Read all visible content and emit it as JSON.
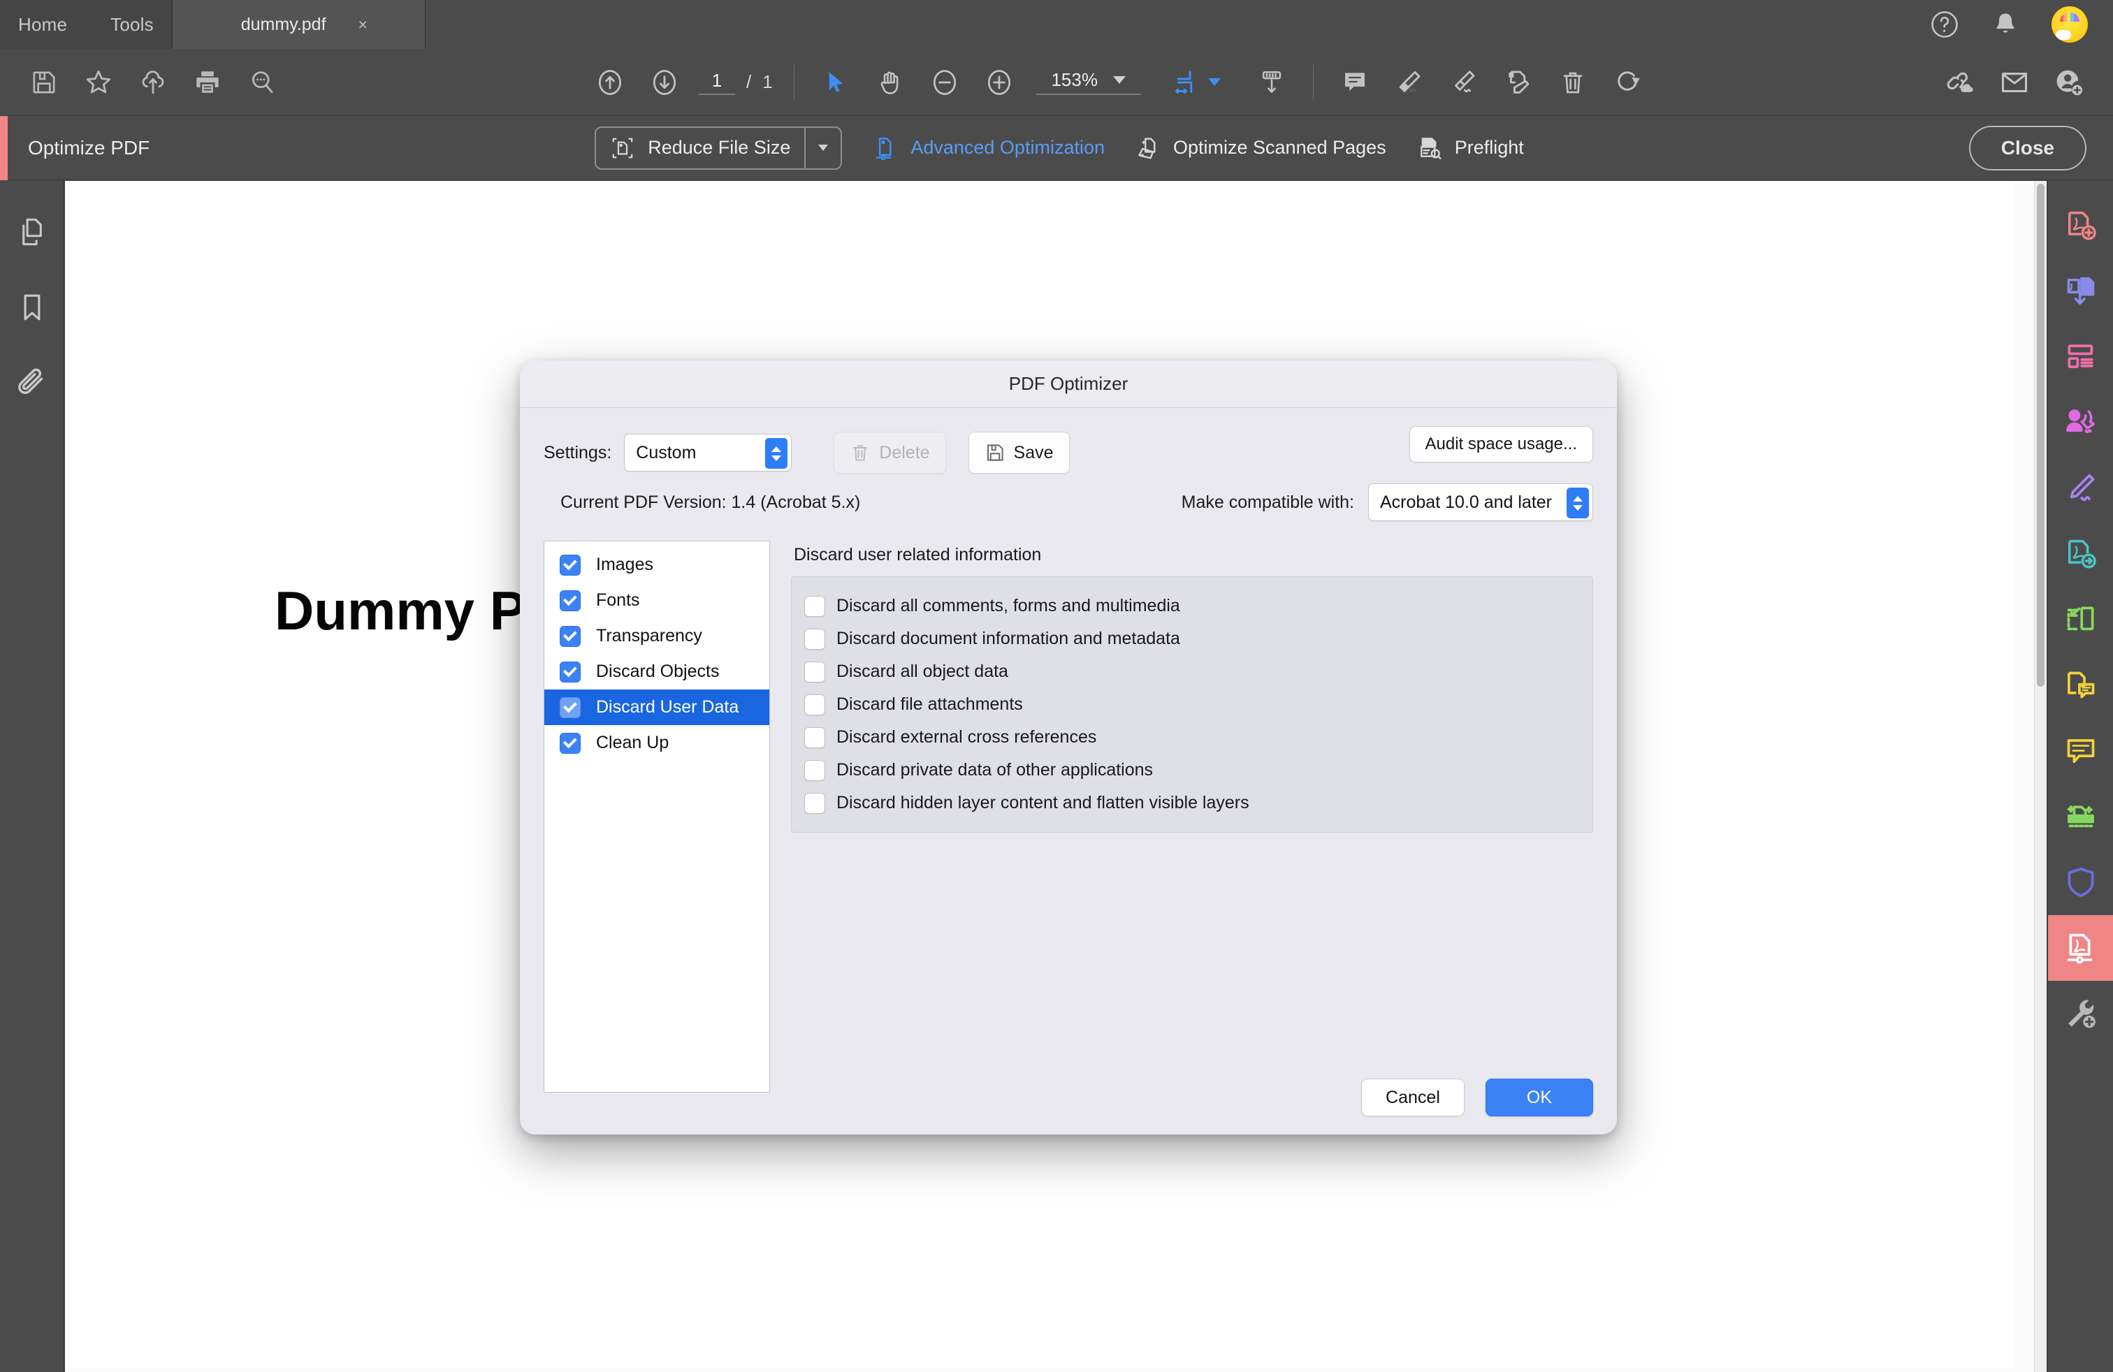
{
  "tabbar": {
    "home_label": "Home",
    "tools_label": "Tools",
    "document_tab": "dummy.pdf",
    "close_tab_glyph": "×",
    "help_icon": "help-circle-icon",
    "bell_icon": "bell-icon",
    "avatar_icon": "user-avatar"
  },
  "toolbar": {
    "save_icon": "save-floppy-icon",
    "star_icon": "star-icon",
    "upload_icon": "cloud-upload-icon",
    "print_icon": "print-icon",
    "findtext_icon": "search-comment-icon",
    "prev_page_icon": "arrow-up-circle-icon",
    "next_page_icon": "arrow-down-circle-icon",
    "page_current": "1",
    "page_sep": "/",
    "page_total": "1",
    "select_tool_icon": "cursor-arrow-icon",
    "hand_tool_icon": "hand-icon",
    "zoom_out_icon": "minus-circle-icon",
    "zoom_in_icon": "plus-circle-icon",
    "zoom_value": "153%",
    "fit_icon": "fit-page-icon",
    "scroll_icon": "scroll-mode-icon",
    "comment_icon": "comment-icon",
    "highlight_icon": "highlighter-icon",
    "sign_icon": "fountain-pen-icon",
    "edit_icon": "edit-pdf-icon",
    "delete_icon": "trash-icon",
    "rotate_icon": "rotate-icon",
    "share_link_icon": "share-link-cloud-icon",
    "email_icon": "envelope-icon",
    "add_person_icon": "add-person-icon"
  },
  "optimize_bar": {
    "title": "Optimize PDF",
    "reduce_file_size": "Reduce File Size",
    "reduce_icon": "reduce-file-size-icon",
    "reduce_dropdown_icon": "chevron-down-icon",
    "advanced_optimization": "Advanced Optimization",
    "advanced_icon": "advanced-optimization-icon",
    "optimize_scanned_pages": "Optimize Scanned Pages",
    "scanned_icon": "optimize-scanned-pages-icon",
    "preflight": "Preflight",
    "preflight_icon": "preflight-icon",
    "close_label": "Close",
    "accent_color": "#ef8585",
    "active_link_color": "#5a9cf8"
  },
  "left_rail": {
    "items": [
      {
        "icon": "page-thumbnails-icon",
        "label": "Page Thumbnails"
      },
      {
        "icon": "bookmarks-icon",
        "label": "Bookmarks"
      },
      {
        "icon": "attachments-paperclip-icon",
        "label": "Attachments"
      }
    ],
    "collapse_icon": "expand-panel-arrow-icon"
  },
  "right_rail": {
    "items": [
      {
        "icon": "create-pdf-icon",
        "color": "#ef8585",
        "selected": false
      },
      {
        "icon": "combine-files-icon",
        "color": "#8a8ae8",
        "selected": false
      },
      {
        "icon": "organize-pages-icon",
        "color": "#ef6fa8",
        "selected": false
      },
      {
        "icon": "request-signatures-icon",
        "color": "#e06ae0",
        "selected": false
      },
      {
        "icon": "fill-and-sign-icon",
        "color": "#a982f0",
        "selected": false
      },
      {
        "icon": "export-pdf-icon",
        "color": "#4cc4c4",
        "selected": false
      },
      {
        "icon": "crop-pages-icon",
        "color": "#86d860",
        "selected": false
      },
      {
        "icon": "stamp-comment-icon",
        "color": "#f2d03c",
        "selected": false
      },
      {
        "icon": "comment-icon",
        "color": "#f2d03c",
        "selected": false
      },
      {
        "icon": "scan-and-ocr-icon",
        "color": "#86d860",
        "selected": false
      },
      {
        "icon": "protect-shield-icon",
        "color": "#6b6bdf",
        "selected": false
      },
      {
        "icon": "optimize-pdf-icon",
        "color": "#ffffff",
        "selected": true
      },
      {
        "icon": "more-tools-wrench-icon",
        "color": "#b8b8b8",
        "selected": false
      }
    ]
  },
  "document": {
    "heading": "Dummy PDF file",
    "scrollbar": "vertical-scrollbar"
  },
  "dialog": {
    "title": "PDF Optimizer",
    "settings_label": "Settings:",
    "settings_value": "Custom",
    "delete_label": "Delete",
    "delete_icon": "trash-icon",
    "save_label": "Save",
    "save_icon": "save-floppy-icon",
    "audit_label": "Audit space usage...",
    "current_version_label": "Current PDF Version: 1.4 (Acrobat 5.x)",
    "compatible_label": "Make compatible with:",
    "compatible_value": "Acrobat 10.0 and later",
    "categories": [
      {
        "label": "Images",
        "checked": true,
        "selected": false
      },
      {
        "label": "Fonts",
        "checked": true,
        "selected": false
      },
      {
        "label": "Transparency",
        "checked": true,
        "selected": false
      },
      {
        "label": "Discard Objects",
        "checked": true,
        "selected": false
      },
      {
        "label": "Discard User Data",
        "checked": true,
        "selected": true
      },
      {
        "label": "Clean Up",
        "checked": true,
        "selected": false
      }
    ],
    "panel_heading": "Discard user related information",
    "options": [
      {
        "label": "Discard all comments, forms and multimedia",
        "checked": false
      },
      {
        "label": "Discard document information and metadata",
        "checked": false
      },
      {
        "label": "Discard all object data",
        "checked": false
      },
      {
        "label": "Discard file attachments",
        "checked": false
      },
      {
        "label": "Discard external cross references",
        "checked": false
      },
      {
        "label": "Discard private data of other applications",
        "checked": false
      },
      {
        "label": "Discard hidden layer content and flatten visible layers",
        "checked": false
      }
    ],
    "cancel_label": "Cancel",
    "ok_label": "OK",
    "accent_color": "#3b82f6",
    "selection_color": "#1a66e0"
  }
}
